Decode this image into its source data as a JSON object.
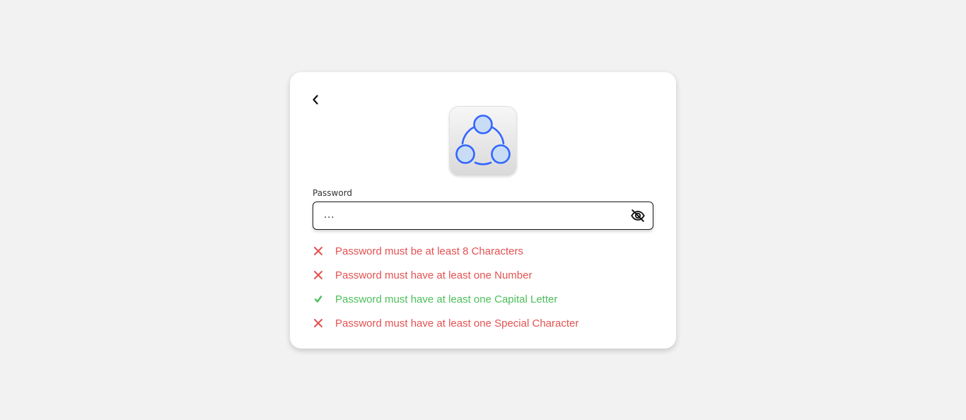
{
  "colors": {
    "background": "#f2f2f2",
    "card": "#ffffff",
    "fail": "#e45151",
    "pass": "#4cbf5c",
    "logo_accent": "#3366ff"
  },
  "header": {
    "back_icon": "chevron-left-icon",
    "logo_icon": "three-circles-logo-icon"
  },
  "password": {
    "label": "Password",
    "value": "...",
    "toggle_icon": "eye-off-icon"
  },
  "rules": [
    {
      "text": "Password must be at least 8 Characters",
      "status": "fail",
      "icon": "cross-icon"
    },
    {
      "text": "Password must have at least one Number",
      "status": "fail",
      "icon": "cross-icon"
    },
    {
      "text": "Password must have at least one Capital Letter",
      "status": "pass",
      "icon": "check-icon"
    },
    {
      "text": "Password must have at least one Special Character",
      "status": "fail",
      "icon": "cross-icon"
    }
  ]
}
